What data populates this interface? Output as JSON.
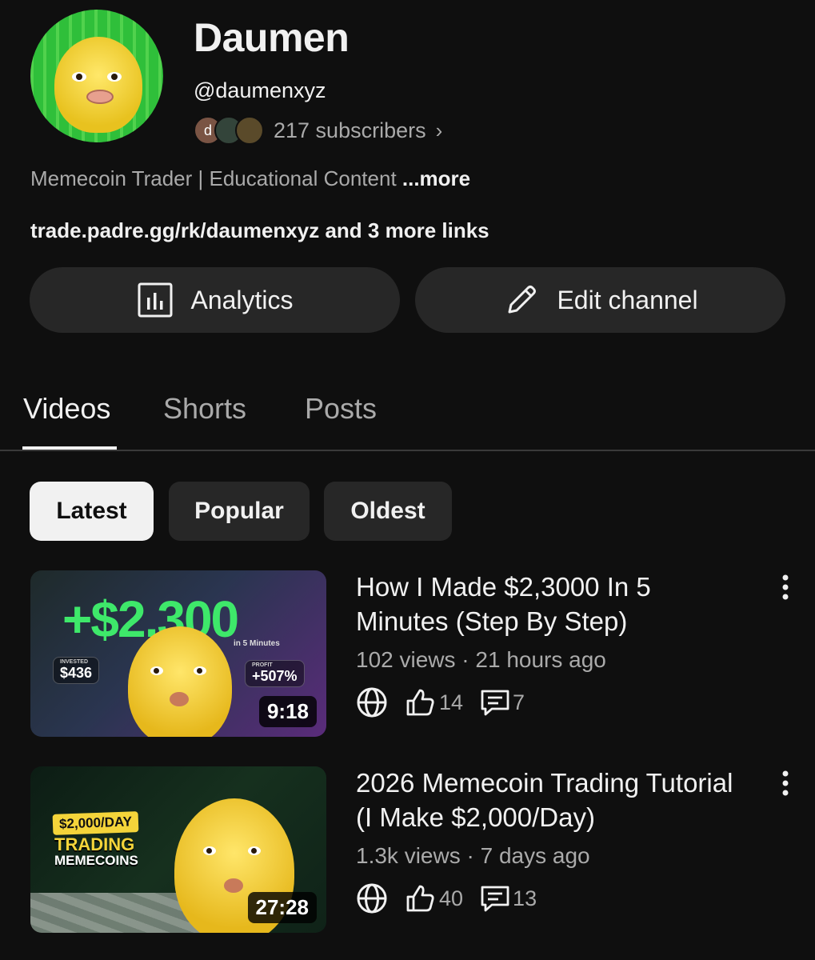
{
  "channel": {
    "name": "Daumen",
    "handle": "@daumenxyz",
    "subscribers": "217 subscribers",
    "subscriber_avatar_initial": "d",
    "description": "Memecoin Trader | Educational Content ",
    "description_more": "...more",
    "links": "trade.padre.gg/rk/daumenxyz and 3 more links"
  },
  "actions": {
    "analytics_label": "Analytics",
    "edit_label": "Edit channel"
  },
  "tabs": [
    {
      "label": "Videos",
      "active": true
    },
    {
      "label": "Shorts",
      "active": false
    },
    {
      "label": "Posts",
      "active": false
    }
  ],
  "filters": [
    {
      "label": "Latest",
      "active": true
    },
    {
      "label": "Popular",
      "active": false
    },
    {
      "label": "Oldest",
      "active": false
    }
  ],
  "videos": [
    {
      "title": "How I Made $2,3000 In 5 Minutes (Step By Step)",
      "meta": "102 views · 21 hours ago",
      "likes": "14",
      "comments": "7",
      "duration": "9:18",
      "thumb_text": {
        "headline": "+$2,300",
        "sub": "in 5 Minutes",
        "invested_label": "INVESTED",
        "invested": "$436",
        "profit_label": "PROFIT",
        "profit": "+507%"
      }
    },
    {
      "title": "2026 Memecoin Trading Tutorial (I Make $2,000/Day)",
      "meta": "1.3k views · 7 days ago",
      "likes": "40",
      "comments": "13",
      "duration": "27:28",
      "thumb_text": {
        "tag": "$2,000/DAY",
        "line1": "TRADING",
        "line2": "MEMECOINS"
      }
    }
  ],
  "colors": {
    "background": "#0f0f0f",
    "surface": "#272727",
    "text_primary": "#f1f1f1",
    "text_secondary": "#aaaaaa",
    "thumb_green": "#3ee86a"
  },
  "icons": [
    "analytics-icon",
    "pencil-icon",
    "globe-icon",
    "thumbs-up-icon",
    "comment-icon",
    "more-vert-icon",
    "chevron-right-icon"
  ]
}
